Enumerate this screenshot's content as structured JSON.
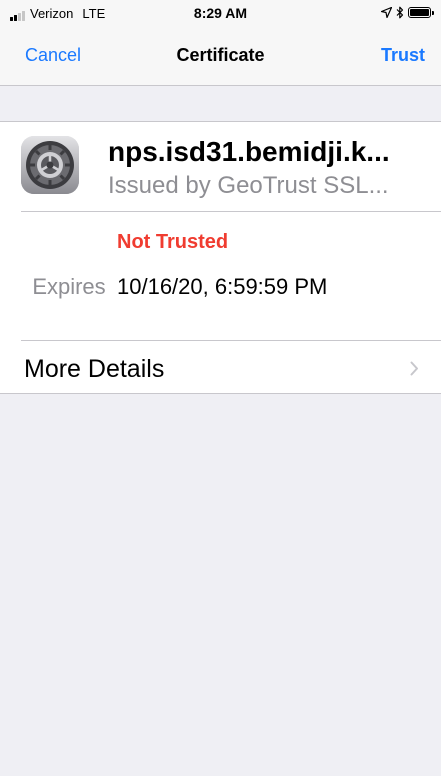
{
  "status_bar": {
    "carrier": "Verizon",
    "network": "LTE",
    "time": "8:29 AM",
    "signal_bars": 4,
    "signal_filled": 2,
    "battery_level": 1.0,
    "icons": [
      "location-arrow-icon",
      "bluetooth-icon",
      "battery-icon"
    ]
  },
  "nav": {
    "cancel_label": "Cancel",
    "title": "Certificate",
    "trust_label": "Trust"
  },
  "certificate": {
    "name": "nps.isd31.bemidji.k...",
    "issuer": "Issued by GeoTrust SSL...",
    "status": "Not Trusted",
    "expires_label": "Expires",
    "expires_value": "10/16/20, 6:59:59 PM",
    "icon": "settings-gear-icon"
  },
  "more_details": {
    "label": "More Details",
    "icon": "chevron-right-icon"
  },
  "colors": {
    "accent": "#1a79ff",
    "danger": "#f03c30",
    "secondary_text": "#8e8e93",
    "background": "#efeff4"
  }
}
